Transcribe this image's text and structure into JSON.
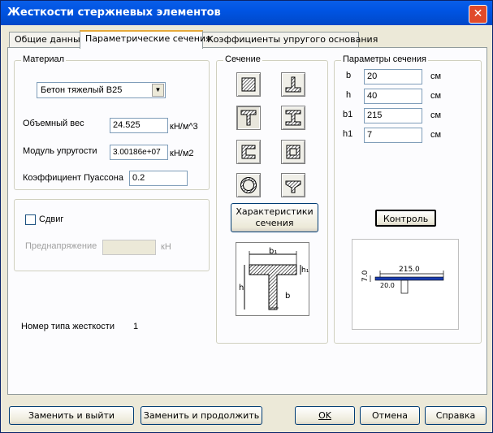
{
  "window": {
    "title": "Жесткости стержневых элементов",
    "close_glyph": "✕"
  },
  "tabs": [
    {
      "label": "Общие данные"
    },
    {
      "label": "Параметрические сечения",
      "active": true
    },
    {
      "label": "Коэффициенты упругого основания"
    }
  ],
  "material": {
    "group_title": "Материал",
    "selected": "Бетон тяжелый В25",
    "weight_label": "Объемный вес",
    "weight_value": "24.525",
    "weight_unit": "кН/м^3",
    "modulus_label": "Модуль упругости",
    "modulus_value": "3.00186e+07",
    "modulus_unit": "кН/м2",
    "poisson_label": "Коэффициент Пуассона",
    "poisson_value": "0.2"
  },
  "shear": {
    "label": "Сдвиг",
    "checked": false,
    "prestress_label": "Преднапряжение",
    "prestress_value": "",
    "prestress_unit": "кН"
  },
  "stiffness_type": {
    "label": "Номер типа жесткости",
    "value": "1"
  },
  "section": {
    "group_title": "Сечение",
    "shapes": [
      {
        "icon": "rectangle-section-icon"
      },
      {
        "icon": "inverted-tee-section-icon"
      },
      {
        "icon": "tee-section-icon",
        "selected": true
      },
      {
        "icon": "i-beam-section-icon"
      },
      {
        "icon": "channel-section-icon"
      },
      {
        "icon": "box-section-icon"
      },
      {
        "icon": "ring-section-icon"
      },
      {
        "icon": "cross-section-icon"
      }
    ],
    "characteristics_button": "Характеристики сечения",
    "diagram": {
      "b1": "b₁",
      "h1": "h₁",
      "h": "h",
      "b": "b"
    }
  },
  "params": {
    "group_title": "Параметры сечения",
    "rows": [
      {
        "name": "b",
        "value": "20",
        "unit": "см"
      },
      {
        "name": "h",
        "value": "40",
        "unit": "см"
      },
      {
        "name": "b1",
        "value": "215",
        "unit": "см"
      },
      {
        "name": "h1",
        "value": "7",
        "unit": "см"
      }
    ],
    "control_button": "Контроль",
    "preview": {
      "width_label": "215.0",
      "height_label": "7.0",
      "web_label": "20.0"
    }
  },
  "footer": {
    "replace_exit": "Заменить и выйти",
    "replace_continue": "Заменить и продолжить",
    "ok": "OK",
    "cancel": "Отмена",
    "help": "Справка"
  }
}
